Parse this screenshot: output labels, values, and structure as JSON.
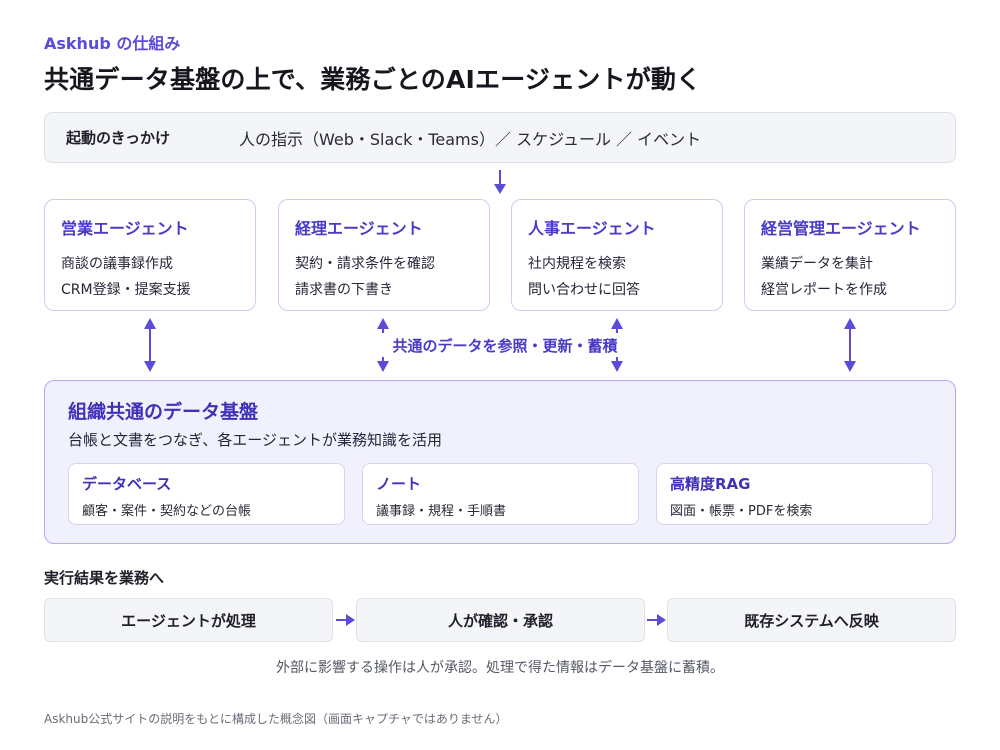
{
  "header": {
    "eyebrow": "Askhub の仕組み",
    "title": "共通データ基盤の上で、業務ごとのAIエージェントが動く"
  },
  "trigger": {
    "label": "起動のきっかけ",
    "text": "人の指示（Web・Slack・Teams）／ スケジュール ／ イベント"
  },
  "agents": [
    {
      "title": "営業エージェント",
      "lines": [
        "商談の議事録作成",
        "CRM登録・提案支援"
      ]
    },
    {
      "title": "経理エージェント",
      "lines": [
        "契約・請求条件を確認",
        "請求書の下書き"
      ]
    },
    {
      "title": "人事エージェント",
      "lines": [
        "社内規程を検索",
        "問い合わせに回答"
      ]
    },
    {
      "title": "経営管理エージェント",
      "lines": [
        "業績データを集計",
        "経営レポートを作成"
      ]
    }
  ],
  "connector_label": "共通のデータを参照・更新・蓄積",
  "foundation": {
    "title": "組織共通のデータ基盤",
    "description": "台帳と文書をつなぎ、各エージェントが業務知識を活用",
    "stores": [
      {
        "title": "データベース",
        "line": "顧客・案件・契約などの台帳"
      },
      {
        "title": "ノート",
        "line": "議事録・規程・手順書"
      },
      {
        "title": "高精度RAG",
        "line": "図面・帳票・PDFを検索"
      }
    ]
  },
  "flow": {
    "heading": "実行結果を業務へ",
    "steps": [
      "エージェントが処理",
      "人が確認・承認",
      "既存システムへ反映"
    ],
    "note": "外部に影響する操作は人が承認。処理で得た情報はデータ基盤に蓄積。"
  },
  "footnote": "Askhub公式サイトの説明をもとに構成した概念図（画面キャプチャではありません）",
  "colors": {
    "accent": "#5b4bd6",
    "accent_dark": "#3f31b8",
    "foundation_bg": "#f1f0fd",
    "panel_bg": "#f4f5f8"
  }
}
